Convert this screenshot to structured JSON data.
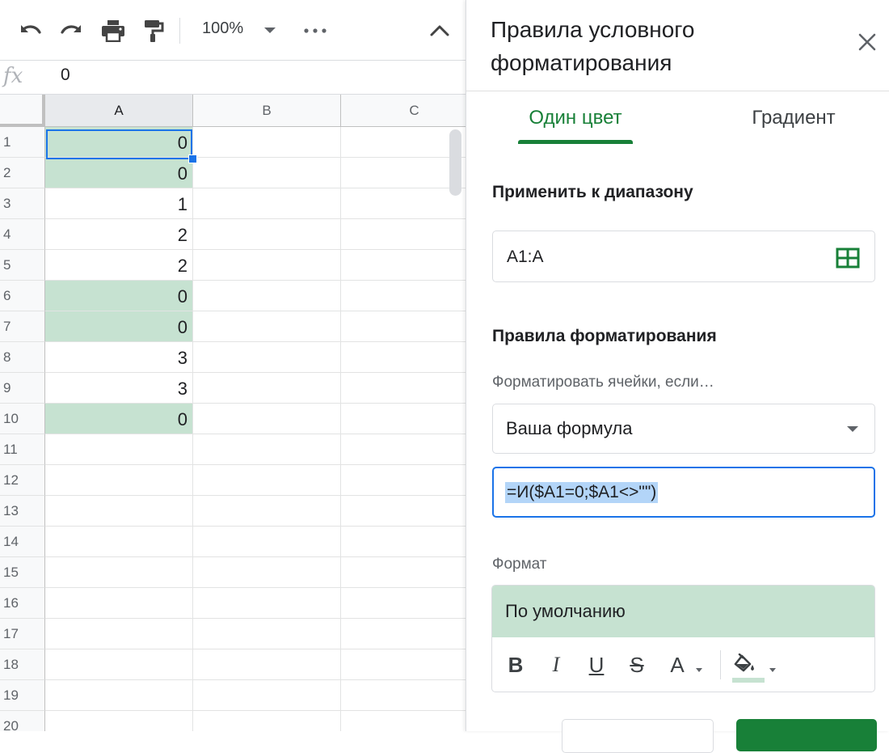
{
  "toolbar": {
    "zoom": "100%",
    "more_label": "•••"
  },
  "formula_bar": {
    "fx_label": "fx",
    "value": "0"
  },
  "sheet": {
    "columns": [
      "A",
      "B",
      "C"
    ],
    "rows": [
      {
        "num": "1",
        "a": "0",
        "highlighted": true
      },
      {
        "num": "2",
        "a": "0",
        "highlighted": true
      },
      {
        "num": "3",
        "a": "1",
        "highlighted": false
      },
      {
        "num": "4",
        "a": "2",
        "highlighted": false
      },
      {
        "num": "5",
        "a": "2",
        "highlighted": false
      },
      {
        "num": "6",
        "a": "0",
        "highlighted": true
      },
      {
        "num": "7",
        "a": "0",
        "highlighted": true
      },
      {
        "num": "8",
        "a": "3",
        "highlighted": false
      },
      {
        "num": "9",
        "a": "3",
        "highlighted": false
      },
      {
        "num": "10",
        "a": "0",
        "highlighted": true
      },
      {
        "num": "11",
        "a": "",
        "highlighted": false
      },
      {
        "num": "12",
        "a": "",
        "highlighted": false
      },
      {
        "num": "13",
        "a": "",
        "highlighted": false
      },
      {
        "num": "14",
        "a": "",
        "highlighted": false
      },
      {
        "num": "15",
        "a": "",
        "highlighted": false
      },
      {
        "num": "16",
        "a": "",
        "highlighted": false
      },
      {
        "num": "17",
        "a": "",
        "highlighted": false
      },
      {
        "num": "18",
        "a": "",
        "highlighted": false
      },
      {
        "num": "19",
        "a": "",
        "highlighted": false
      },
      {
        "num": "20",
        "a": "",
        "highlighted": false
      }
    ],
    "highlight_color": "#c6e2d1",
    "selection_color": "#1a73e8"
  },
  "panel": {
    "title": "Правила условного форматирования",
    "tabs": [
      {
        "label": "Один цвет",
        "active": true
      },
      {
        "label": "Градиент",
        "active": false
      }
    ],
    "apply_range_heading": "Применить к диапазону",
    "range_value": "A1:A",
    "rules_heading": "Правила форматирования",
    "condition_label": "Форматировать ячейки, если…",
    "condition_value": "Ваша формула",
    "formula_value": "=И($A1=0;$A1<>\"\")",
    "format_label": "Формат",
    "format_preview": "По умолчанию",
    "format_buttons": {
      "bold": "B",
      "italic": "I",
      "underline": "U",
      "strikethrough": "S",
      "text_color": "A"
    },
    "accent_color": "#188038",
    "preview_fill": "#c6e2d1"
  }
}
